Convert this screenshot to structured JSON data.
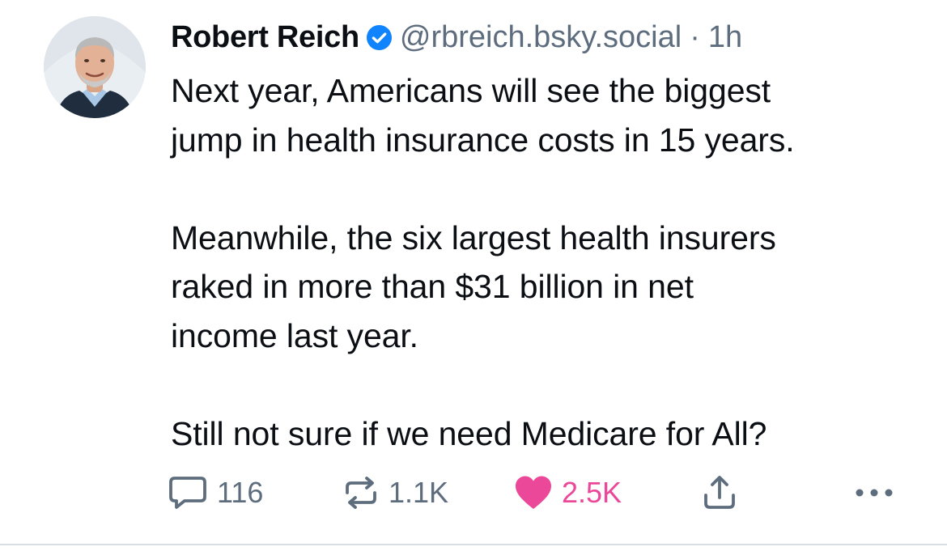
{
  "post": {
    "author": {
      "display_name": "Robert Reich",
      "handle": "@rbreich.bsky.social",
      "verified": true,
      "avatar_icon": "profile-photo"
    },
    "separator": "·",
    "time": "1h",
    "paragraphs": [
      "Next year, Americans will see the biggest\njump in health insurance costs in 15 years.",
      "Meanwhile, the six largest health insurers\nraked in more than $31 billion in net\nincome last year.",
      "Still not sure if we need Medicare for All?"
    ],
    "stats": {
      "replies": "116",
      "reposts": "1.1K",
      "likes": "2.5K"
    },
    "liked": true
  },
  "icons": {
    "reply": "reply-bubble-icon",
    "repost": "repost-arrows-icon",
    "like": "heart-icon",
    "share": "share-upload-icon",
    "more": "more-dots-icon",
    "verified": "verified-check-icon"
  },
  "colors": {
    "text": "#0b0f14",
    "muted": "#5e6d7d",
    "verified_blue": "#1083fe",
    "like_pink": "#ec4899",
    "divider": "#d9dee3"
  }
}
